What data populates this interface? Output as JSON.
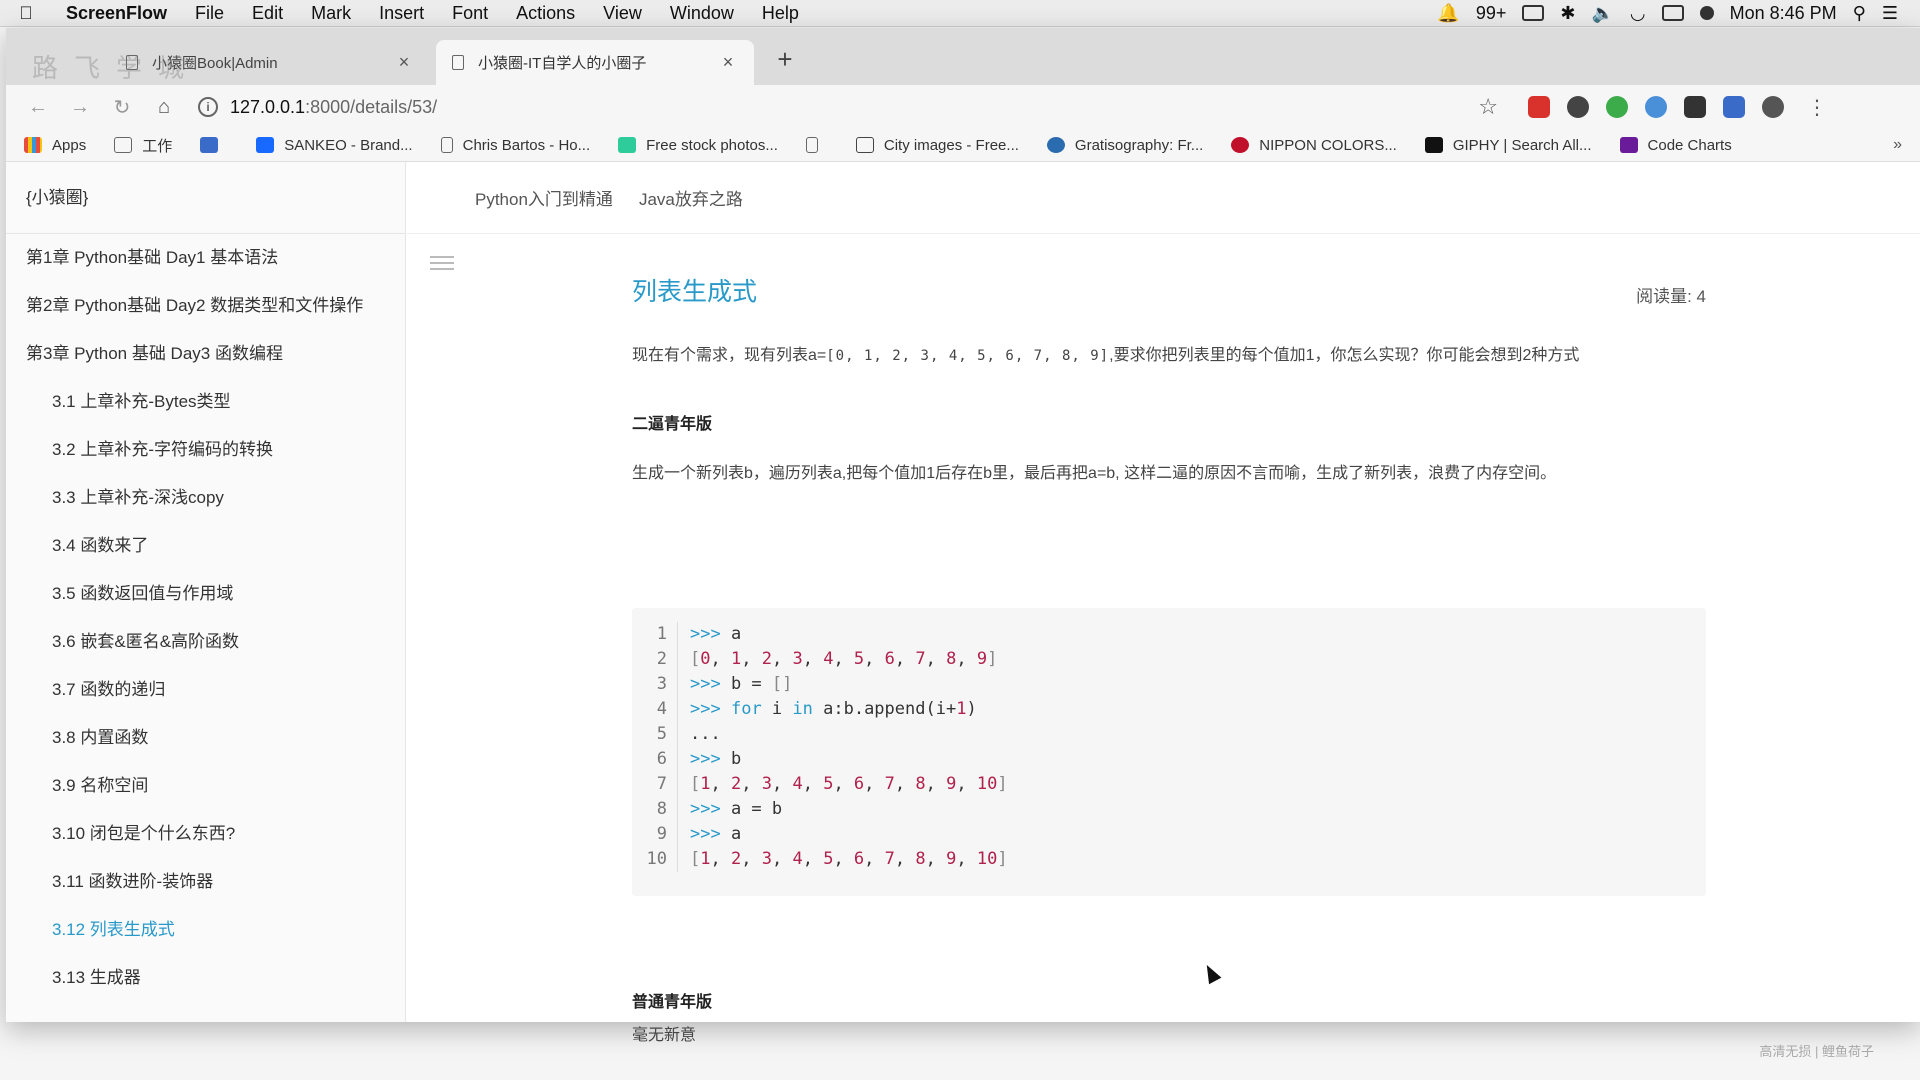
{
  "menubar": {
    "app": "ScreenFlow",
    "items": [
      "File",
      "Edit",
      "Mark",
      "Insert",
      "Font",
      "Actions",
      "View",
      "Window",
      "Help"
    ],
    "notifications": "99+",
    "clock": "Mon 8:46 PM"
  },
  "tabs": [
    {
      "label": "小猿圈Book|Admin"
    },
    {
      "label": "小猿圈-IT自学人的小圈子"
    }
  ],
  "tab_ghost_text": "路飞学城",
  "address": {
    "host": "127.0.0.1",
    "path": ":8000/details/53/"
  },
  "bookmarks": [
    "Apps",
    "工作",
    "",
    "SANKEO - Brand...",
    "Chris Bartos - Ho...",
    "Free stock photos...",
    "",
    "City images - Free...",
    "Gratisography: Fr...",
    "NIPPON COLORS...",
    "GIPHY | Search All...",
    "Code Charts"
  ],
  "sidebar": {
    "brand": "{小猿圈}",
    "items": [
      {
        "label": "第1章 Python基础 Day1 基本语法",
        "level": 0
      },
      {
        "label": "第2章 Python基础 Day2 数据类型和文件操作",
        "level": 0
      },
      {
        "label": "第3章 Python 基础 Day3 函数编程",
        "level": 0
      },
      {
        "label": "3.1 上章补充-Bytes类型",
        "level": 1
      },
      {
        "label": "3.2 上章补充-字符编码的转换",
        "level": 1
      },
      {
        "label": "3.3 上章补充-深浅copy",
        "level": 1
      },
      {
        "label": "3.4 函数来了",
        "level": 1
      },
      {
        "label": "3.5 函数返回值与作用域",
        "level": 1
      },
      {
        "label": "3.6 嵌套&匿名&高阶函数",
        "level": 1
      },
      {
        "label": "3.7 函数的递归",
        "level": 1
      },
      {
        "label": "3.8 内置函数",
        "level": 1
      },
      {
        "label": "3.9 名称空间",
        "level": 1
      },
      {
        "label": "3.10 闭包是个什么东西?",
        "level": 1
      },
      {
        "label": "3.11 函数进阶-装饰器",
        "level": 1
      },
      {
        "label": "3.12 列表生成式",
        "level": 1,
        "active": true
      },
      {
        "label": "3.13 生成器",
        "level": 1
      }
    ]
  },
  "topnav": [
    "Python入门到精通",
    "Java放弃之路"
  ],
  "article": {
    "title": "列表生成式",
    "reads": "阅读量: 4",
    "intro_pre": "现在有个需求，现有列表a=",
    "intro_code": "[0, 1, 2, 3, 4, 5, 6, 7, 8, 9]",
    "intro_post": ",要求你把列表里的每个值加1，你怎么实现？你可能会想到2种方式",
    "h1": "二逼青年版",
    "para2": "生成一个新列表b，遍历列表a,把每个值加1后存在b里，最后再把a=b, 这样二逼的原因不言而喻，生成了新列表，浪费了内存空间。",
    "code_lines": [
      ">>> a",
      "[0, 1, 2, 3, 4, 5, 6, 7, 8, 9]",
      ">>> b = []",
      ">>> for i in a:b.append(i+1)",
      "...",
      ">>> b",
      "[1, 2, 3, 4, 5, 6, 7, 8, 9, 10]",
      ">>> a = b",
      ">>> a",
      "[1, 2, 3, 4, 5, 6, 7, 8, 9, 10]"
    ],
    "h2": "普通青年版",
    "para3": "毫无新意"
  },
  "watermark": "高清无损 | 鲤鱼荷子",
  "colors": {
    "accent": "#2899c9",
    "number": "#b0214d"
  }
}
